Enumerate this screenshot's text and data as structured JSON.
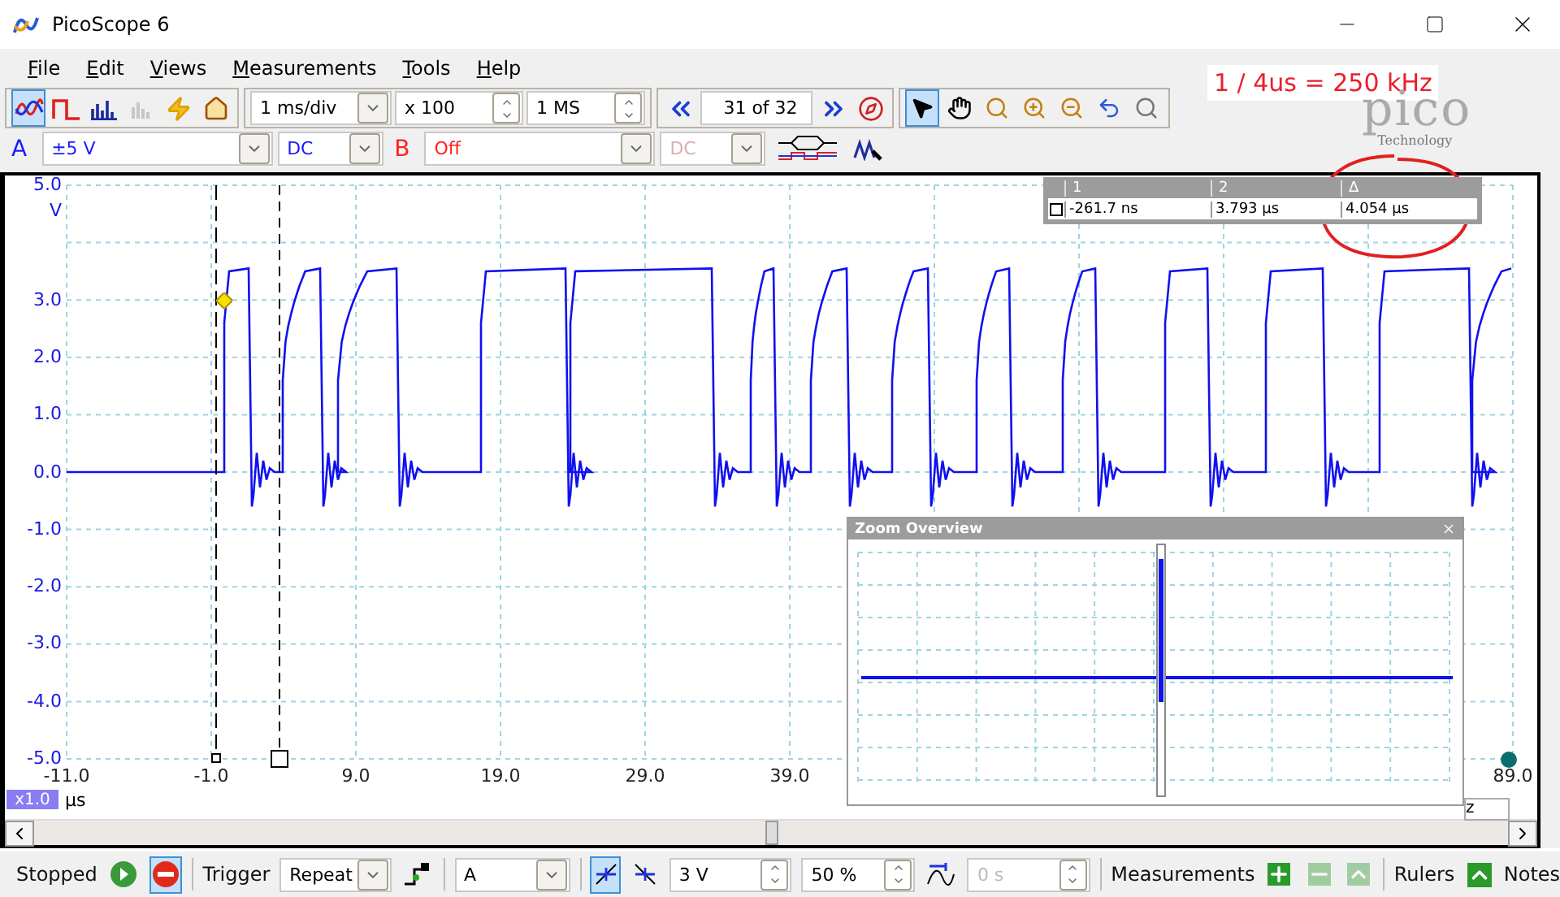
{
  "window": {
    "title": "PicoScope 6"
  },
  "menu": [
    "File",
    "Edit",
    "Views",
    "Measurements",
    "Tools",
    "Help"
  ],
  "modes": [
    {
      "kind": "scope",
      "selected": true
    },
    {
      "kind": "persistence",
      "selected": false
    },
    {
      "kind": "spectrum",
      "selected": false
    }
  ],
  "capture": {
    "timebase": "1 ms/div",
    "zoom": "x 100",
    "samples": "1 MS",
    "buffer": "31 of 32"
  },
  "tools": [
    {
      "kind": "pointer",
      "selected": true
    },
    {
      "kind": "hand",
      "selected": false
    },
    {
      "kind": "zoom-box",
      "selected": false
    },
    {
      "kind": "zoom-in",
      "selected": false
    },
    {
      "kind": "zoom-out",
      "selected": false
    },
    {
      "kind": "undo",
      "selected": false
    }
  ],
  "channels": [
    {
      "name": "A",
      "range": "±5 V",
      "coupling": "DC",
      "color": "#1a1aff",
      "enabled": true
    },
    {
      "name": "B",
      "range": "Off",
      "coupling": "DC",
      "color": "#ff2020",
      "enabled": false
    }
  ],
  "annotation": "1 / 4us = 250 kHz",
  "logo": {
    "name": "pico",
    "tagline": "Technology"
  },
  "scope": {
    "y_unit": "V",
    "y_labels": [
      "5.0",
      "3.0",
      "2.0",
      "1.0",
      "0.0",
      "-1.0",
      "-2.0",
      "-3.0",
      "-4.0",
      "-5.0"
    ],
    "x_labels": [
      "-11.0",
      "-1.0",
      "9.0",
      "19.0",
      "29.0",
      "39.0",
      "89.0"
    ],
    "x_unit": "µs",
    "zoom_factor": "x1.0",
    "hidden_field": "z"
  },
  "rulers_table": {
    "columns": [
      "1",
      "2",
      "Δ"
    ],
    "values": [
      "-261.7 ns",
      "3.793 µs",
      "4.054 µs"
    ]
  },
  "zoom_overview": {
    "title": "Zoom Overview"
  },
  "status": {
    "state": "Stopped",
    "trigger_label": "Trigger",
    "trigger_mode": "Repeat",
    "trigger_source": "A",
    "threshold": "3 V",
    "pretrigger": "50 %",
    "delay": "0 s",
    "measurements": "Measurements",
    "rulers": "Rulers",
    "notes": "Notes"
  },
  "run_buttons": [
    {
      "kind": "start",
      "selected": false
    },
    {
      "kind": "stop",
      "selected": true
    }
  ],
  "edges": [
    {
      "kind": "rising",
      "selected": true
    },
    {
      "kind": "falling",
      "selected": false
    }
  ]
}
